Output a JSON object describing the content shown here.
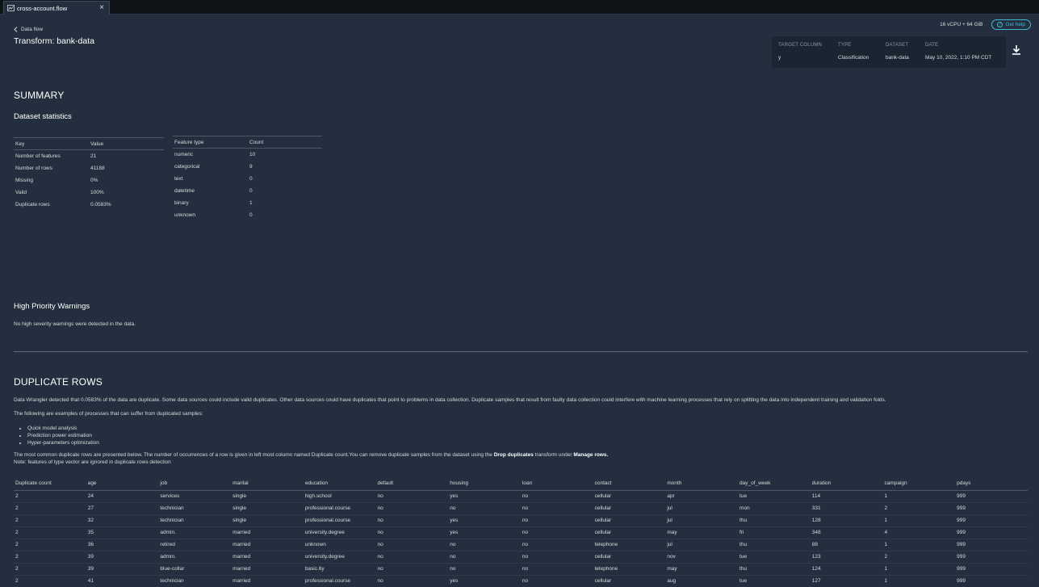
{
  "tab": {
    "title": "cross-account.flow",
    "close": "×"
  },
  "header": {
    "resources": "16 vCPU + 64 GiB",
    "help_label": "Get help",
    "back_label": "Data flow",
    "title": "Transform: bank-data"
  },
  "meta": {
    "target_column_label": "TARGET COLUMN",
    "target_column": "y",
    "type_label": "TYPE",
    "type": "Classification",
    "dataset_label": "DATASET",
    "dataset": "bank-data",
    "date_label": "DATE",
    "date": "May 10, 2022, 1:10 PM CDT"
  },
  "summary": {
    "title": "SUMMARY",
    "stats_title": "Dataset statistics",
    "stats_headers": [
      "Key",
      "Value"
    ],
    "stats_rows": [
      [
        "Number of features",
        "21"
      ],
      [
        "Number of rows",
        "41188"
      ],
      [
        "Missing",
        "0%"
      ],
      [
        "Valid",
        "100%"
      ],
      [
        "Duplicate rows",
        "0.0583%"
      ]
    ],
    "type_headers": [
      "Feature type",
      "Count"
    ],
    "type_rows": [
      [
        "numeric",
        "10"
      ],
      [
        "categorical",
        "9"
      ],
      [
        "text",
        "0"
      ],
      [
        "datetime",
        "0"
      ],
      [
        "binary",
        "1"
      ],
      [
        "unknown",
        "0"
      ]
    ]
  },
  "warnings": {
    "title": "High Priority Warnings",
    "text": "No high severity warnings were detected in the data."
  },
  "duplicates": {
    "title": "DUPLICATE ROWS",
    "para1": "Data Wrangler detected that 0.0583% of the data are duplicate. Some data sources could include valid duplicates. Other data sources could have duplicates that point to problems in data collection. Duplicate samples that result from faulty data collection could interfere with machine learning processes that rely on splitting the data into independent training and validation folds.",
    "para2": "The following are examples of processes that can suffer from duplicated samples:",
    "bullets": [
      "Quick model analysis",
      "Prediction power estimation",
      "Hyper-parameters optimization"
    ],
    "para3_a": "The most common duplicate rows are presented below. The number of occurrences of a row is given in left most column named Duplicate count.You can remove duplicate samples from the dataset using the ",
    "para3_b": "Drop duplicates",
    "para3_c": " transform under ",
    "para3_d": "Manage rows.",
    "para4": "Note: features of type vector are ignored in duplicate rows detection",
    "columns": [
      "Duplicate count",
      "age",
      "job",
      "marital",
      "education",
      "default",
      "housing",
      "loan",
      "contact",
      "month",
      "day_of_week",
      "duration",
      "campaign",
      "pdays"
    ],
    "rows": [
      [
        "2",
        "24",
        "services",
        "single",
        "high.school",
        "no",
        "yes",
        "no",
        "cellular",
        "apr",
        "tue",
        "114",
        "1",
        "999"
      ],
      [
        "2",
        "27",
        "technician",
        "single",
        "professional.course",
        "no",
        "no",
        "no",
        "cellular",
        "jul",
        "mon",
        "331",
        "2",
        "999"
      ],
      [
        "2",
        "32",
        "technician",
        "single",
        "professional.course",
        "no",
        "yes",
        "no",
        "cellular",
        "jul",
        "thu",
        "128",
        "1",
        "999"
      ],
      [
        "2",
        "35",
        "admin.",
        "married",
        "university.degree",
        "no",
        "yes",
        "no",
        "cellular",
        "may",
        "fri",
        "348",
        "4",
        "999"
      ],
      [
        "2",
        "36",
        "retired",
        "married",
        "unknown",
        "no",
        "no",
        "no",
        "telephone",
        "jul",
        "thu",
        "88",
        "1",
        "999"
      ],
      [
        "2",
        "39",
        "admin.",
        "married",
        "university.degree",
        "no",
        "no",
        "no",
        "cellular",
        "nov",
        "tue",
        "123",
        "2",
        "999"
      ],
      [
        "2",
        "39",
        "blue-collar",
        "married",
        "basic.6y",
        "no",
        "no",
        "no",
        "telephone",
        "may",
        "thu",
        "124",
        "1",
        "999"
      ],
      [
        "2",
        "41",
        "technician",
        "married",
        "professional.course",
        "no",
        "yes",
        "no",
        "cellular",
        "aug",
        "tue",
        "127",
        "1",
        "999"
      ]
    ]
  }
}
